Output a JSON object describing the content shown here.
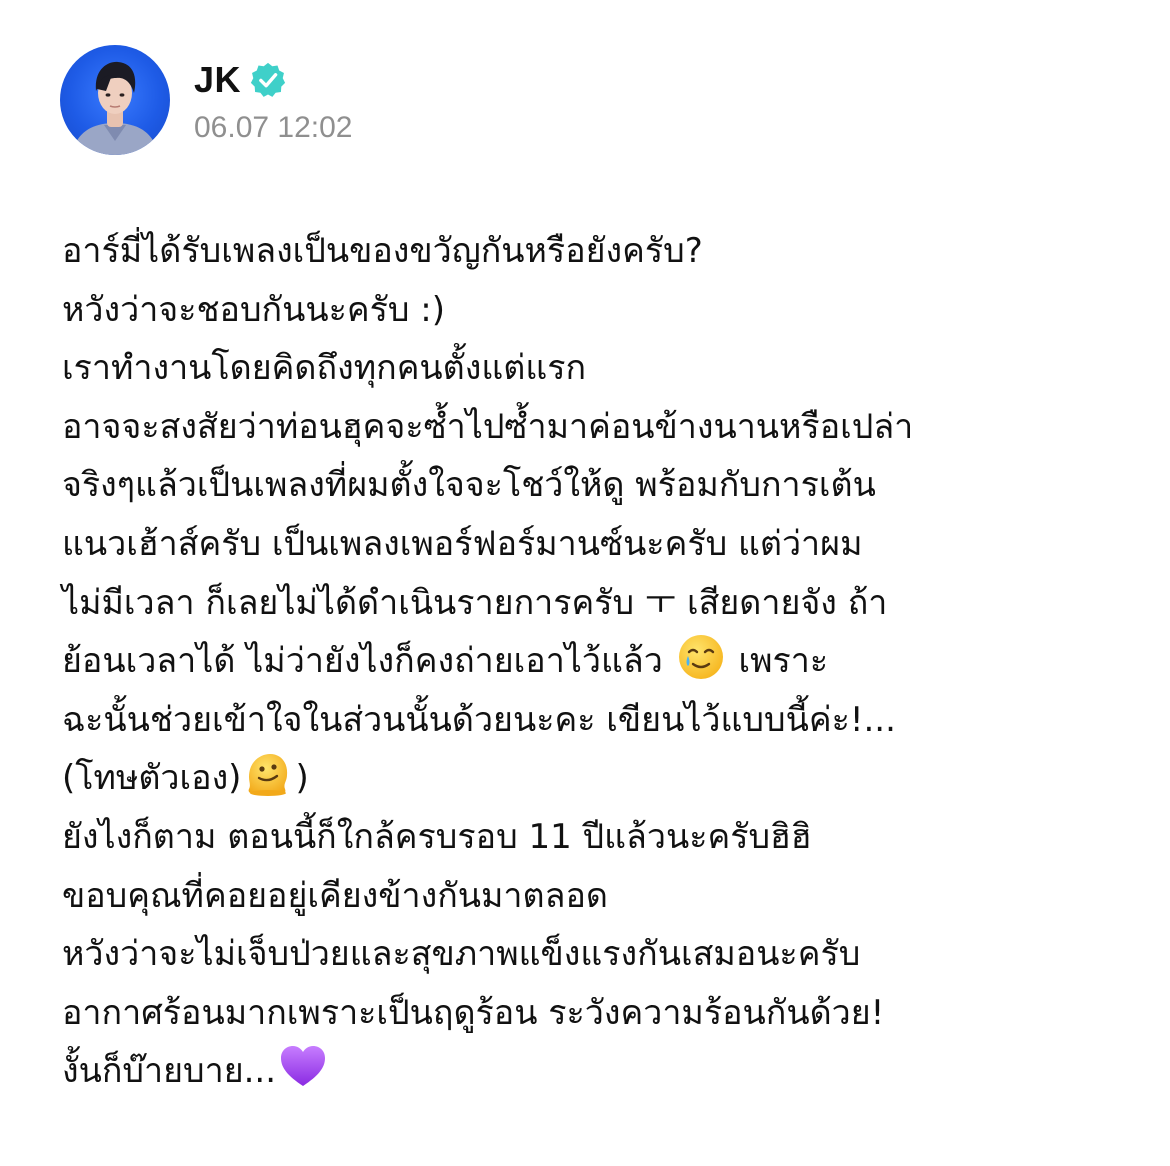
{
  "author": {
    "name": "JK",
    "verified": true,
    "verified_color": "#3fd0c9",
    "avatar_bg": "#1e5be6"
  },
  "timestamp": "06.07 12:02",
  "body": {
    "lines": [
      "อาร์มี่ได้รับเพลงเป็นของขวัญกันหรือยังครับ?",
      "หวังว่าจะชอบกันนะครับ :)",
      "เราทำงานโดยคิดถึงทุกคนตั้งแต่แรก",
      "อาจจะสงสัยว่าท่อนฮุคจะซ้ำไปซ้ำมาค่อนข้างนานหรือเปล่า",
      "จริงๆแล้วเป็นเพลงที่ผมตั้งใจจะโชว์ให้ดู พร้อมกับการเต้น",
      "แนวเฮ้าส์ครับ เป็นเพลงเพอร์ฟอร์มานซ์นะครับ แต่ว่าผม",
      "ไม่มีเวลา ก็เลยไม่ได้ดำเนินรายการครับ ㅜ เสียดายจัง ถ้า",
      "ย้อนเวลาได้ ไม่ว่ายังไงก็คงถ่ายเอาไว้แล้ว",
      "เพราะ",
      "ฉะนั้นช่วยเข้าใจในส่วนนั้นด้วยนะคะ เขียนไว้แบบนี้ค่ะ!...",
      "(โทษตัวเอง)",
      ")",
      "ยังไงก็ตาม ตอนนี้ก็ใกล้ครบรอบ 11 ปีแล้วนะครับฮิฮิ",
      "ขอบคุณที่คอยอยู่เคียงข้างกันมาตลอด",
      "หวังว่าจะไม่เจ็บป่วยและสุขภาพแข็งแรงกันเสมอนะครับ",
      "อากาศร้อนมากเพราะเป็นฤดูร้อน ระวังความร้อนกันด้วย!",
      "งั้นก็บ๊ายบาย..."
    ],
    "emojis": {
      "crying_face": "smiling-face-with-tear-icon",
      "melting_face": "melting-face-icon",
      "purple_heart": "purple-heart-icon"
    }
  }
}
